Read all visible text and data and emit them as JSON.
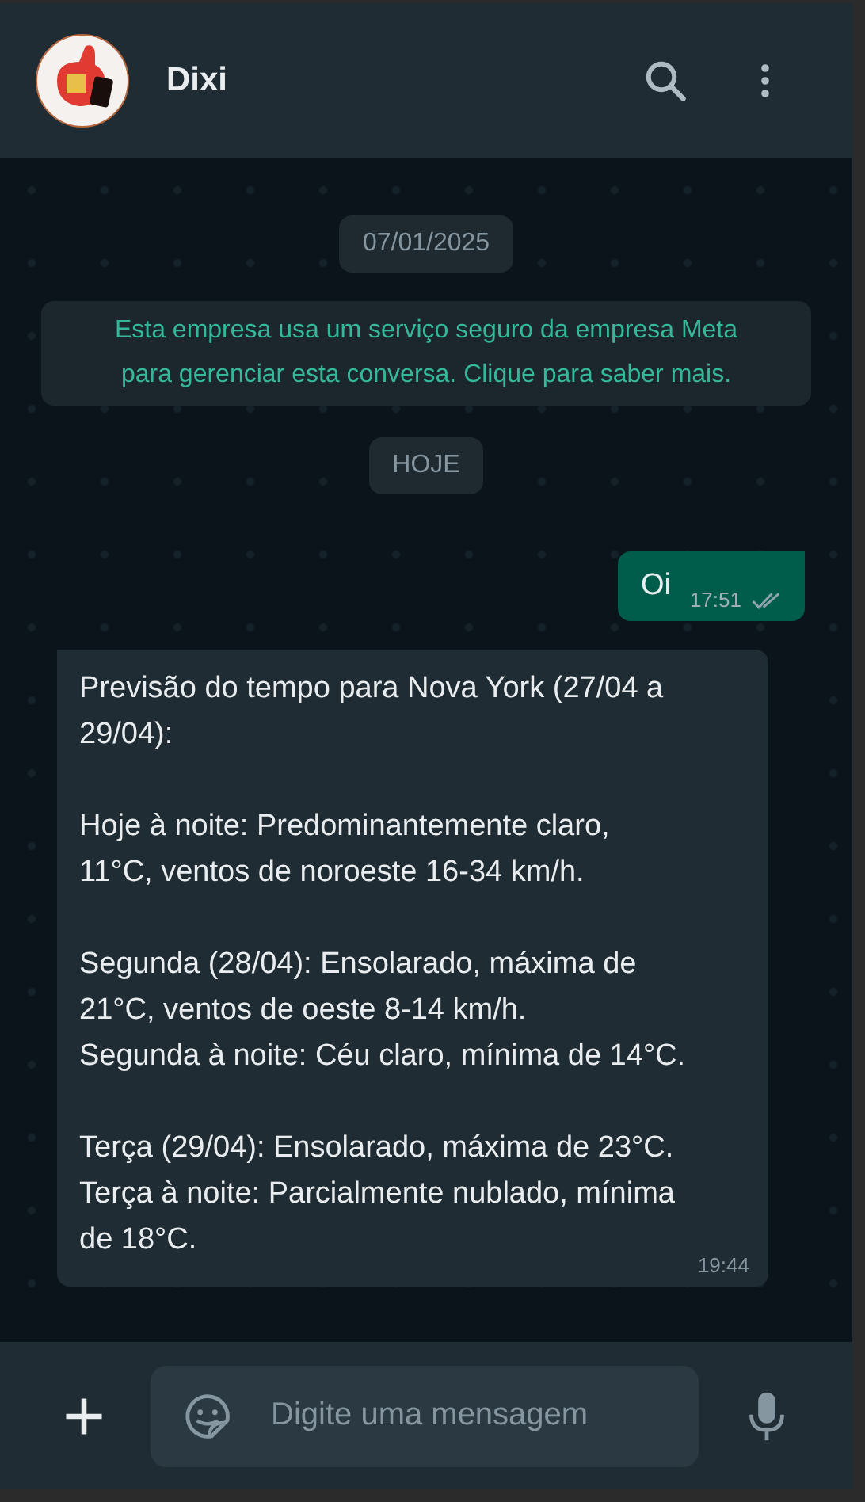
{
  "header": {
    "contact_name": "Dixi"
  },
  "messages": [
    {
      "kind": "date",
      "text": "07/01/2025"
    },
    {
      "kind": "notice",
      "text": "Esta empresa usa um serviço seguro da empresa Meta para gerenciar esta conversa. Clique para saber mais."
    },
    {
      "kind": "date",
      "text": "HOJE"
    },
    {
      "kind": "outgoing",
      "text": "Oi",
      "time": "17:51",
      "read": false
    },
    {
      "kind": "incoming",
      "text": "Previsão do tempo para Nova York (27/04 a 29/04):\n\nHoje à noite: Predominantemente claro, 11°C, ventos de noroeste 16-34 km/h.\n\nSegunda (28/04): Ensolarado, máxima de 21°C, ventos de oeste 8-14 km/h.\nSegunda à noite: Céu claro, mínima de 14°C.\n\nTerça (29/04): Ensolarado, máxima de 23°C.\nTerça à noite: Parcialmente nublado, mínima de 18°C.",
      "time": "19:44"
    }
  ],
  "composer": {
    "placeholder": "Digite uma mensagem"
  }
}
